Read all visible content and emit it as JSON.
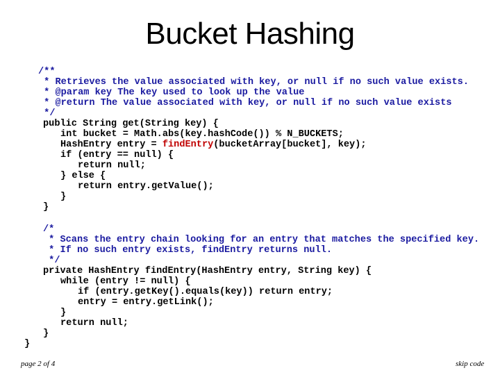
{
  "slide": {
    "title": "Bucket Hashing",
    "footer_left": "page 2 of 4",
    "footer_right": "skip code"
  },
  "colors": {
    "comment": "#1a1aa0",
    "highlight": "#c00000",
    "code": "#000000"
  },
  "code": {
    "get_method": {
      "comment": [
        "/**",
        " * Retrieves the value associated with key, or null if no such value exists.",
        " * @param key The key used to look up the value",
        " * @return The value associated with key, or null if no such value exists",
        " */"
      ],
      "line_signature": "public String get(String key) {",
      "line_bucket": "int bucket = Math.abs(key.hashCode()) % N_BUCKETS;",
      "line_entry_prefix": "HashEntry entry = ",
      "line_entry_highlight": "findEntry",
      "line_entry_suffix": "(bucketArray[bucket], key);",
      "line_if": "if (entry == null) {",
      "line_return_null": "return null;",
      "line_else": "} else {",
      "line_return_value": "return entry.getValue();",
      "line_close_if": "}",
      "line_close_method": "}"
    },
    "find_entry_method": {
      "comment": [
        "/*",
        " * Scans the entry chain looking for an entry that matches the specified key.",
        " * If no such entry exists, findEntry returns null.",
        " */"
      ],
      "line_signature": "private HashEntry findEntry(HashEntry entry, String key) {",
      "line_while": "while (entry != null) {",
      "line_if_match": "if (entry.getKey().equals(key)) return entry;",
      "line_advance": "entry = entry.getLink();",
      "line_close_while": "}",
      "line_return_null": "return null;",
      "line_close_method": "}"
    },
    "line_close_class": "}"
  }
}
